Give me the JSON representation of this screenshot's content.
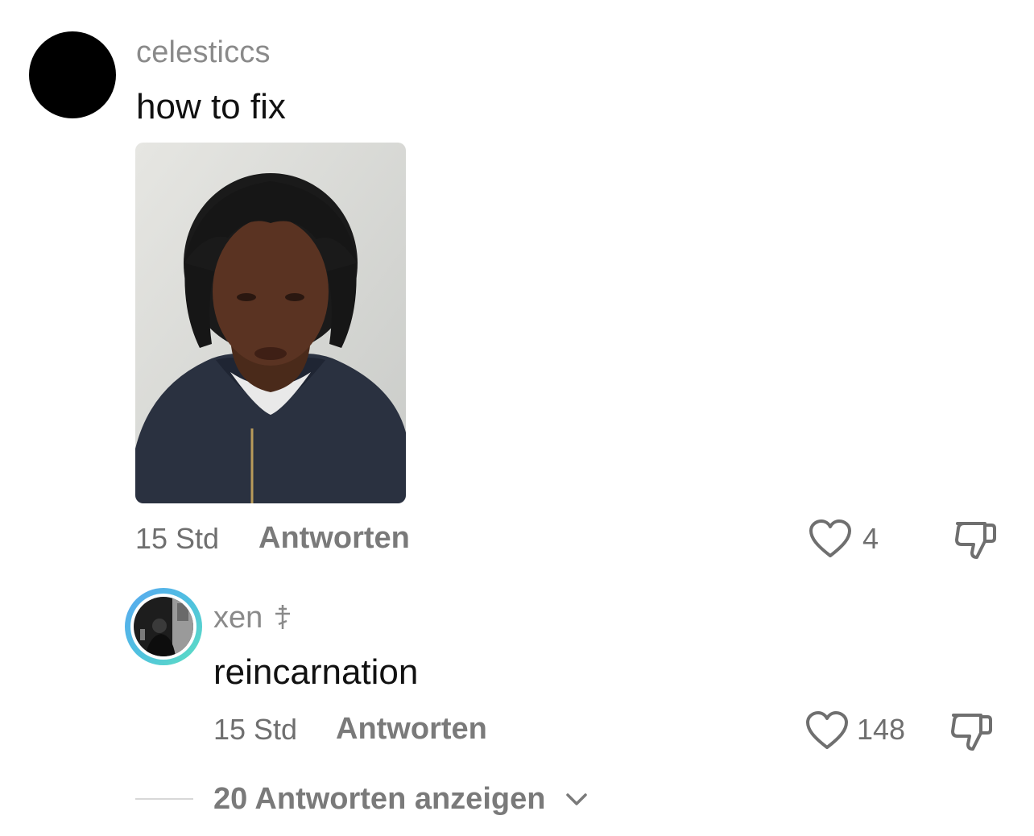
{
  "comment": {
    "username": "celesticcs",
    "text": "how to fix",
    "time": "15 Std",
    "reply_label": "Antworten",
    "likes": "4"
  },
  "reply": {
    "username": "xen",
    "text": "reincarnation",
    "time": "15 Std",
    "reply_label": "Antworten",
    "likes": "148"
  },
  "view_replies_label": "20 Antworten anzeigen",
  "icons": {
    "like": "heart-outline-icon",
    "dislike": "thumbs-down-icon",
    "username_badge": "orthodox-cross-icon",
    "expand": "chevron-down-icon"
  },
  "colors": {
    "background": "#ffffff",
    "primary_text": "#111111",
    "secondary_text": "#7a7a7a",
    "avatar_ring_start": "#5aa8f0",
    "avatar_ring_end": "#5ee0c0"
  }
}
